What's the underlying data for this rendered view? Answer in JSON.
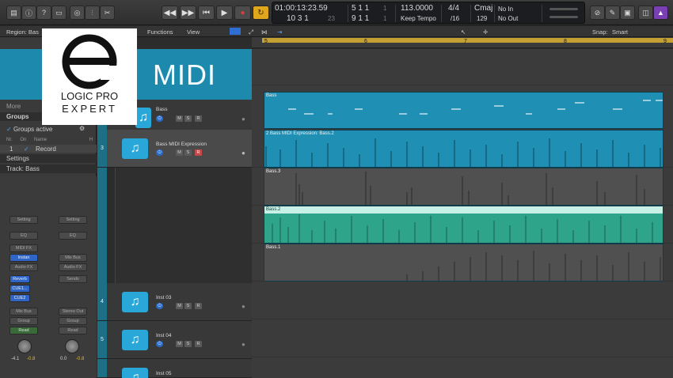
{
  "control_bar": {
    "buttons_left": [
      "library",
      "inspector",
      "quick-help",
      "toolbar",
      "smart-controls",
      "mixer",
      "editors"
    ],
    "transport": [
      "rewind",
      "fast-forward",
      "go-to-start",
      "play",
      "record",
      "cycle"
    ],
    "lcd": {
      "time": "01:00:13:23.59",
      "bars_top": "5  1  1",
      "bars_top_sub": "1",
      "bars_bottom": "10  3  1",
      "bars_bottom_sub": "23",
      "loc_top": "5  1  1",
      "loc_top_sub": "1",
      "loc_bottom": "9  1  1",
      "loc_bottom_sub": "1",
      "tempo": "113.0000",
      "tempo_mode": "Keep Tempo",
      "sig": "4/4",
      "division": "/16",
      "key": "Cmaj",
      "cpu": "129",
      "in": "No In",
      "out": "No Out"
    }
  },
  "region_bar": {
    "region_label": "Region: Bas",
    "menus": [
      "Functions",
      "View"
    ],
    "snap_label": "Snap:",
    "snap_value": "Smart"
  },
  "banner": {
    "title": "MIDI",
    "logo_line1": "LOGIC PRO",
    "logo_line2": "EXPERT"
  },
  "inspector": {
    "more": "More",
    "groups": "Groups",
    "groups_active": "Groups active",
    "cols": [
      "Nr.",
      "On",
      "Name",
      "H"
    ],
    "group_row": {
      "nr": "1",
      "name": "Record"
    },
    "settings": "Settings",
    "track": "Track:  Bass",
    "strip_left": {
      "setting": "Setting",
      "eq": "EQ",
      "midi_fx": "MIDI FX",
      "instrument": "Instan",
      "audio_fx": "Audio FX",
      "send1": "Reverb",
      "send2": "CUE1...",
      "send3": "CUE2",
      "output": "Mix Bus",
      "group": "Group",
      "auto": "Read",
      "vol": "-4.1",
      "pan": "-0.8"
    },
    "strip_right": {
      "setting": "Setting",
      "eq": "EQ",
      "input": "Mix Bus",
      "audio_fx": "Audio FX",
      "sends": "Sends",
      "output": "Stereo Out",
      "group": "Group",
      "auto": "Read",
      "vol": "0.0",
      "pan": "-0.8"
    }
  },
  "tracks": [
    {
      "num": "",
      "name": "Bass"
    },
    {
      "num": "3",
      "name": "Bass MIDI Expression"
    },
    {
      "num": "4",
      "name": "Inst 03"
    },
    {
      "num": "5",
      "name": "Inst 04"
    },
    {
      "num": "",
      "name": "Inst 05"
    }
  ],
  "ruler": {
    "bars": [
      "5",
      "6",
      "7",
      "8",
      "9"
    ]
  },
  "regions": {
    "bass": "Bass",
    "folder": "2  Bass MIDI Expression: Bass.2",
    "r3": "Bass.3",
    "r2": "Bass.2",
    "r1": "Bass.1"
  },
  "colors": {
    "track_blue": "#1f8fb3",
    "region_green": "#2ea58a",
    "region_gray": "#505050",
    "banner": "#1d8aad",
    "cycle": "#c4a033"
  }
}
